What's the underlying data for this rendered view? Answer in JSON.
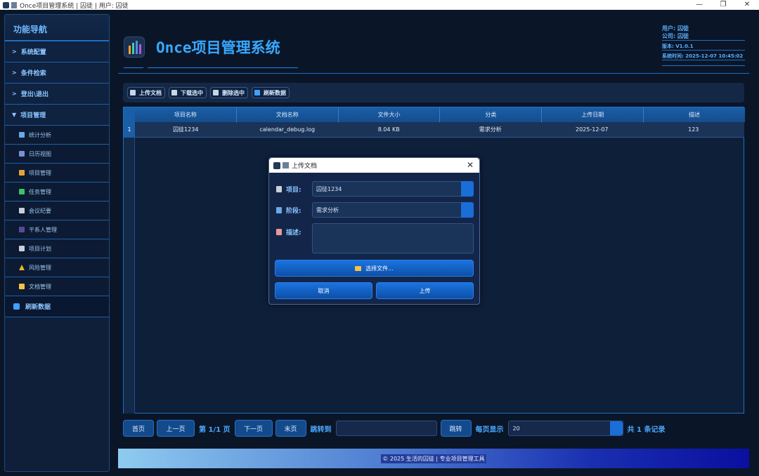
{
  "window": {
    "title": "Once项目管理系统 | 囚徒 | 用户: 囚徒",
    "controls": [
      "—",
      "❐",
      "✕"
    ]
  },
  "sidebar": {
    "title": "功能导航",
    "items": [
      {
        "label": "系统配置",
        "caret": ">"
      },
      {
        "label": "条件检索",
        "caret": ">"
      },
      {
        "label": "登出\\退出",
        "caret": ">"
      },
      {
        "label": "项目管理",
        "caret": "▼"
      }
    ],
    "subitems": [
      {
        "label": "统计分析",
        "icon": "chart-icon",
        "color": "#6aa9e8"
      },
      {
        "label": "日历视图",
        "icon": "calendar-icon",
        "color": "#7d8fd6"
      },
      {
        "label": "项目管理",
        "icon": "project-icon",
        "color": "#e8a13a"
      },
      {
        "label": "任务管理",
        "icon": "task-check-icon",
        "color": "#3cc26a"
      },
      {
        "label": "会议纪要",
        "icon": "meeting-notes-icon",
        "color": "#c8d0dc"
      },
      {
        "label": "干系人管理",
        "icon": "stakeholder-icon",
        "color": "#5a4a9a"
      },
      {
        "label": "项目计划",
        "icon": "plan-icon",
        "color": "#c8d0dc"
      },
      {
        "label": "风险管理",
        "icon": "warning-icon",
        "color": "#f0b429"
      },
      {
        "label": "文档管理",
        "icon": "folder-icon",
        "color": "#f5c243"
      }
    ],
    "refresh": "刷新数据"
  },
  "header": {
    "app_title": "Once项目管理系统",
    "user": "用户: 囚徒",
    "company": "公司: 囚徒",
    "version": "版本: V1.0.1",
    "system_time": "系统时间: 2025-12-07 10:45:02"
  },
  "toolbar": {
    "upload": "上传文档",
    "download": "下载选中",
    "delete": "删除选中",
    "refresh": "刷新数据"
  },
  "table": {
    "columns": [
      "项目名称",
      "文档名称",
      "文件大小",
      "分类",
      "上传日期",
      "描述"
    ],
    "rows": [
      {
        "num": "1",
        "cells": [
          "囚徒1234",
          "calendar_debug.log",
          "8.04 KB",
          "需求分析",
          "2025-12-07",
          "123"
        ]
      }
    ]
  },
  "pager": {
    "first": "首页",
    "prev": "上一页",
    "page_info": "第 1/1 页",
    "next": "下一页",
    "last": "末页",
    "jump_label": "跳转到",
    "jump_value": "",
    "jump_button": "跳转",
    "per_page_label": "每页显示",
    "per_page_value": "20",
    "total": "共 1 条记录"
  },
  "footer": {
    "text": "© 2025 生活的囚徒 | 专业项目管理工具"
  },
  "dialog": {
    "title": "上传文档",
    "close": "✕",
    "project_label": "项目:",
    "project_value": "囚徒1234",
    "stage_label": "阶段:",
    "stage_value": "需求分析",
    "desc_label": "描述:",
    "choose_file": "选择文件...",
    "cancel": "取消",
    "upload": "上传"
  }
}
